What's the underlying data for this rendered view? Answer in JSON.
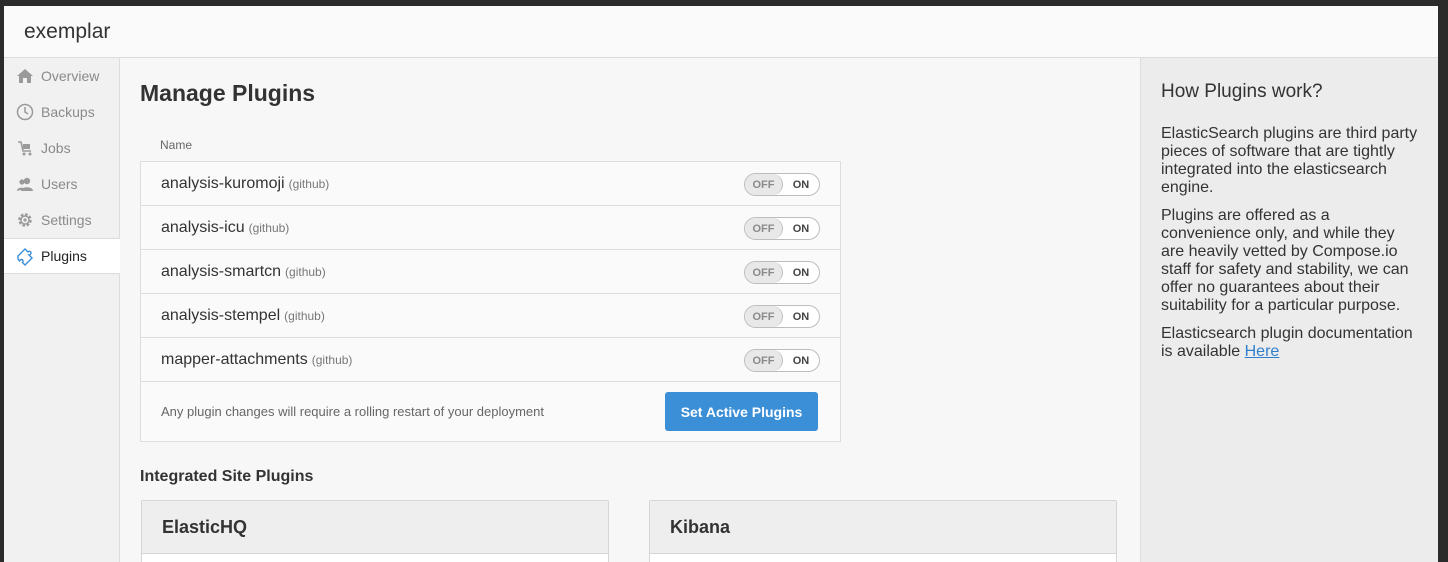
{
  "app": {
    "title": "exemplar"
  },
  "sidebar": {
    "items": [
      {
        "label": "Overview",
        "icon": "home-icon",
        "active": false
      },
      {
        "label": "Backups",
        "icon": "history-icon",
        "active": false
      },
      {
        "label": "Jobs",
        "icon": "jobs-icon",
        "active": false
      },
      {
        "label": "Users",
        "icon": "users-icon",
        "active": false
      },
      {
        "label": "Settings",
        "icon": "gear-icon",
        "active": false
      },
      {
        "label": "Plugins",
        "icon": "plugin-icon",
        "active": true
      }
    ]
  },
  "main": {
    "title": "Manage Plugins",
    "table": {
      "column_header": "Name",
      "rows": [
        {
          "name": "analysis-kuromoji",
          "source": "(github)",
          "off_label": "OFF",
          "on_label": "ON",
          "state": "off"
        },
        {
          "name": "analysis-icu",
          "source": "(github)",
          "off_label": "OFF",
          "on_label": "ON",
          "state": "off"
        },
        {
          "name": "analysis-smartcn",
          "source": "(github)",
          "off_label": "OFF",
          "on_label": "ON",
          "state": "off"
        },
        {
          "name": "analysis-stempel",
          "source": "(github)",
          "off_label": "OFF",
          "on_label": "ON",
          "state": "off"
        },
        {
          "name": "mapper-attachments",
          "source": "(github)",
          "off_label": "OFF",
          "on_label": "ON",
          "state": "off"
        }
      ],
      "footer_note": "Any plugin changes will require a rolling restart of your deployment",
      "submit_label": "Set Active Plugins"
    },
    "site_plugins": {
      "title": "Integrated Site Plugins",
      "cards": [
        {
          "name": "ElasticHQ"
        },
        {
          "name": "Kibana"
        }
      ]
    }
  },
  "aside": {
    "title": "How Plugins work?",
    "p1": "ElasticSearch plugins are third party pieces of software that are tightly integrated into the elasticsearch engine.",
    "p2": "Plugins are offered as a convenience only, and while they are heavily vetted by Compose.io staff for safety and stability, we can offer no guarantees about their suitability for a particular purpose.",
    "p3_text": "Elasticsearch plugin documentation is available ",
    "p3_link": "Here"
  },
  "colors": {
    "accent": "#3b8fd6",
    "link": "#2f7fcf"
  }
}
